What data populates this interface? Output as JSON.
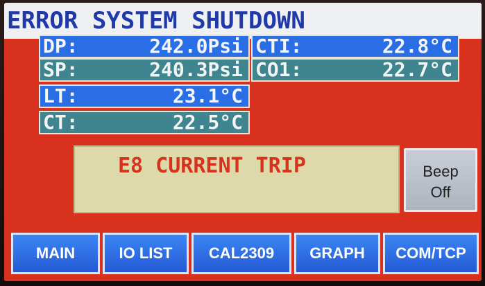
{
  "header": {
    "title": "ERROR SYSTEM SHUTDOWN"
  },
  "readings": [
    {
      "label": "DP:",
      "value": "242.0Psi"
    },
    {
      "label": "CTI:",
      "value": "22.8°C"
    },
    {
      "label": "SP:",
      "value": "240.3Psi"
    },
    {
      "label": "CO1:",
      "value": "22.7°C"
    },
    {
      "label": "LT:",
      "value": "23.1°C"
    },
    {
      "label": "CT:",
      "value": "22.5°C"
    }
  ],
  "alarm": {
    "message": "E8 CURRENT TRIP"
  },
  "beep_button": {
    "line1": "Beep",
    "line2": "Off"
  },
  "nav": [
    {
      "label": "MAIN"
    },
    {
      "label": "IO LIST"
    },
    {
      "label": "CAL2309"
    },
    {
      "label": "GRAPH"
    },
    {
      "label": "COM/TCP"
    }
  ],
  "colors": {
    "screen_bg": "#d8321e",
    "title_bg": "#eef0f2",
    "title_text": "#1f3aa8",
    "reading_blue": "#2a6ee6",
    "reading_teal": "#3f8590",
    "alarm_bg": "#ddd9a8",
    "alarm_text": "#d8321e",
    "nav_button": "#2f6ee4"
  }
}
